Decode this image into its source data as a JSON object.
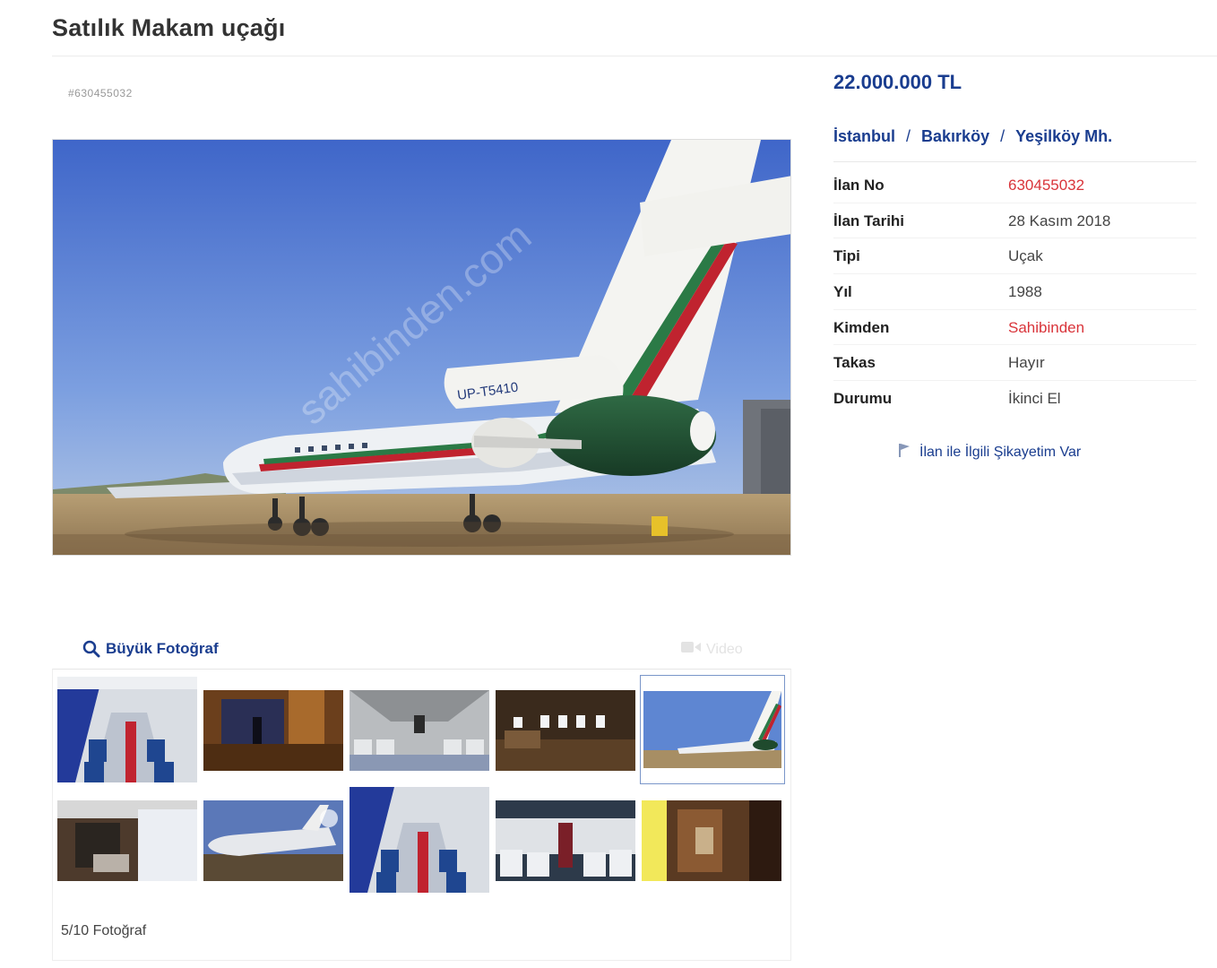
{
  "header": {
    "title": "Satılık Makam uçağı"
  },
  "listing": {
    "id_label": "#630455032"
  },
  "main_photo": {
    "watermark": "sahibinden.com",
    "tail_registration": "UP-T5410"
  },
  "gallery": {
    "big_photo_label": "Büyük Fotoğraf",
    "video_label": "Video",
    "photo_counter": "5/10 Fotoğraf",
    "selected_index": 5,
    "thumbnails": [
      {
        "subject": "cabin-aisle-blue-seats"
      },
      {
        "subject": "vip-cabin-wood"
      },
      {
        "subject": "cabin-seats-wide"
      },
      {
        "subject": "cabin-windows-table"
      },
      {
        "subject": "aircraft-exterior-tail"
      },
      {
        "subject": "cabin-galley"
      },
      {
        "subject": "aircraft-exterior-side"
      },
      {
        "subject": "cabin-aisle-blue-seats-2"
      },
      {
        "subject": "cabin-seats-rear"
      },
      {
        "subject": "cabin-lounge-yellow"
      }
    ]
  },
  "details": {
    "price": "22.000.000 TL",
    "location": {
      "city": "İstanbul",
      "district": "Bakırköy",
      "neighborhood": "Yeşilköy Mh.",
      "separator": "/"
    },
    "rows": [
      {
        "key": "İlan No",
        "value": "630455032",
        "highlight": true
      },
      {
        "key": "İlan Tarihi",
        "value": "28 Kasım 2018",
        "highlight": false
      },
      {
        "key": "Tipi",
        "value": "Uçak",
        "highlight": false
      },
      {
        "key": "Yıl",
        "value": "1988",
        "highlight": false
      },
      {
        "key": "Kimden",
        "value": "Sahibinden",
        "highlight": true
      },
      {
        "key": "Takas",
        "value": "Hayır",
        "highlight": false
      },
      {
        "key": "Durumu",
        "value": "İkinci El",
        "highlight": false
      }
    ],
    "complaint_label": "İlan ile İlgili Şikayetim Var"
  },
  "colors": {
    "link_blue": "#1a3d8f",
    "highlight_red": "#d9343a"
  }
}
